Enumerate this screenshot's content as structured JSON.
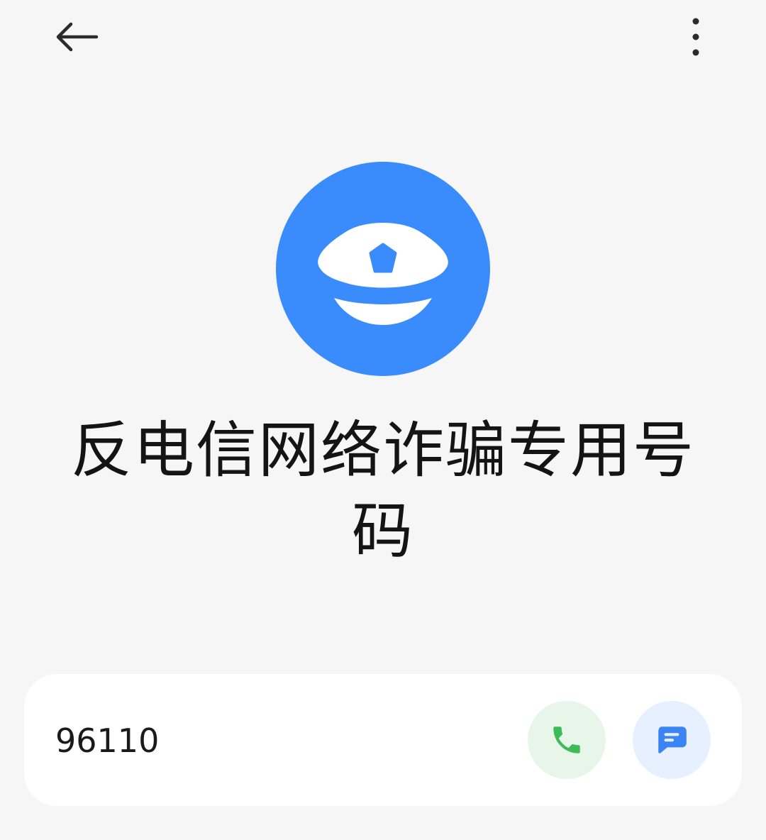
{
  "header": {
    "back_icon": "arrow-left-icon",
    "more_icon": "more-vertical-icon"
  },
  "contact": {
    "avatar_icon": "police-cap-icon",
    "avatar_color": "#3a8cfd",
    "name": "反电信网络诈骗专用号码",
    "number": "96110"
  },
  "actions": {
    "call_icon": "phone-icon",
    "call_color": "#3dbb58",
    "message_icon": "message-icon",
    "message_color": "#3a84f3"
  }
}
